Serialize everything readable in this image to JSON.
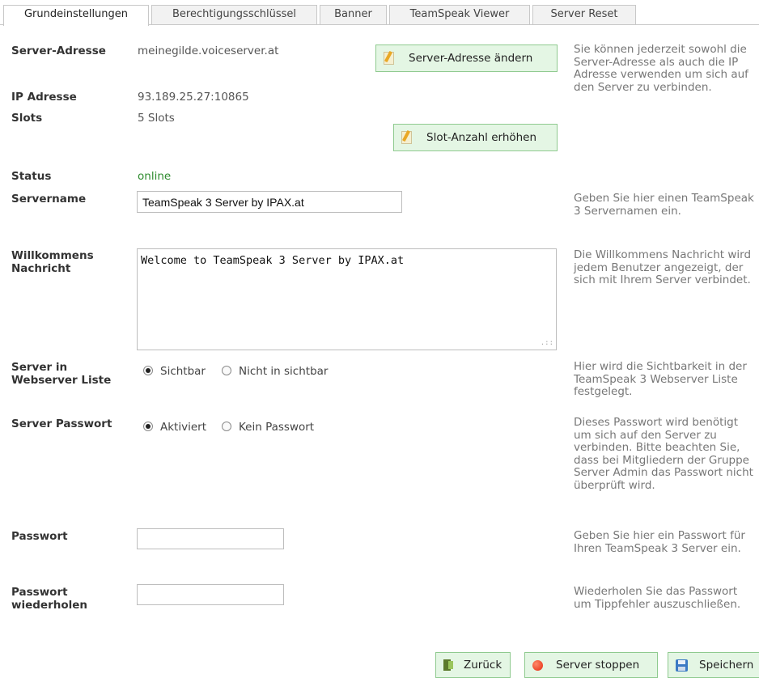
{
  "tabs": [
    {
      "label": "Grundeinstellungen",
      "active": true
    },
    {
      "label": "Berechtigungsschlüssel",
      "active": false
    },
    {
      "label": "Banner",
      "active": false
    },
    {
      "label": "TeamSpeak Viewer",
      "active": false
    },
    {
      "label": "Server Reset",
      "active": false
    }
  ],
  "server_address": {
    "label": "Server-Adresse",
    "value": "meinegilde.voiceserver.at",
    "change_button": "Server-Adresse ändern"
  },
  "ip_address": {
    "label": "IP Adresse",
    "value": "93.189.25.27:10865"
  },
  "slots": {
    "label": "Slots",
    "value": "5 Slots",
    "increase_button": "Slot-Anzahl erhöhen"
  },
  "status": {
    "label": "Status",
    "value": "online"
  },
  "server_name": {
    "label": "Servername",
    "value": "TeamSpeak 3 Server by IPAX.at",
    "help": "Geben Sie hier einen TeamSpeak 3 Servernamen ein."
  },
  "welcome_message": {
    "label_line1": "Willkommens",
    "label_line2": "Nachricht",
    "value": "Welcome to TeamSpeak 3 Server by IPAX.at",
    "help": "Die Willkommens Nachricht wird jedem Benutzer angezeigt, der sich mit Ihrem Server verbindet."
  },
  "address_help": "Sie können jederzeit sowohl die Server-Adresse als auch die IP Adresse verwenden um sich auf den Server zu verbinden.",
  "webserver_list": {
    "label_line1": "Server in",
    "label_line2": "Webserver Liste",
    "option_visible": "Sichtbar",
    "option_hidden": "Nicht in sichtbar",
    "selected": "Sichtbar",
    "help": "Hier wird die Sichtbarkeit in der TeamSpeak 3 Webserver Liste festgelegt."
  },
  "server_password": {
    "label": "Server Passwort",
    "option_on": "Aktiviert",
    "option_off": "Kein Passwort",
    "selected": "Aktiviert",
    "help": "Dieses Passwort wird benötigt um sich auf den Server zu verbinden. Bitte beachten Sie, dass bei Mitgliedern der Gruppe Server Admin das Passwort nicht überprüft wird."
  },
  "password": {
    "label": "Passwort",
    "value": "",
    "help": "Geben Sie hier ein Passwort für Ihren TeamSpeak 3 Server ein."
  },
  "password_repeat": {
    "label_line1": "Passwort",
    "label_line2": "wiederholen",
    "value": "",
    "help": "Wiederholen Sie das Passwort um Tippfehler auszuschließen."
  },
  "actions": {
    "back": "Zurück",
    "stop": "Server stoppen",
    "save": "Speichern"
  },
  "colors": {
    "button_bg": "#e4f6e4",
    "button_border": "#8fca8f",
    "status_online": "#2e8b2e"
  }
}
